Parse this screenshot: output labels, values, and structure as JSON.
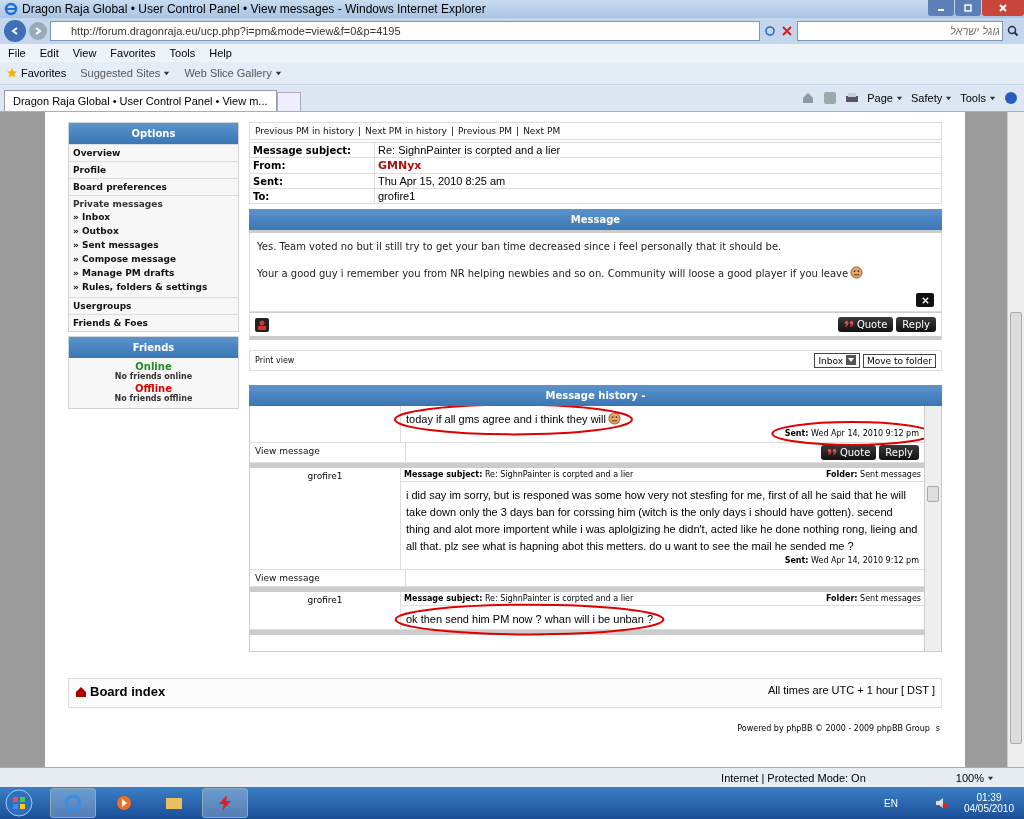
{
  "browser": {
    "title": "Dragon Raja Global • User Control Panel • View messages - Windows Internet Explorer",
    "address": "http://forum.dragonraja.eu/ucp.php?i=pm&mode=view&f=0&p=4195",
    "search_placeholder": "גוגל ישראל",
    "menu": [
      "File",
      "Edit",
      "View",
      "Favorites",
      "Tools",
      "Help"
    ],
    "favorites": "Favorites",
    "fav_links": [
      "Suggested Sites",
      "Web Slice Gallery"
    ],
    "tab": "Dragon Raja Global • User Control Panel • View m...",
    "commands": [
      "Page",
      "Safety",
      "Tools"
    ]
  },
  "sidebar": {
    "title": "Options",
    "items": [
      {
        "label": "Overview"
      },
      {
        "label": "Profile"
      },
      {
        "label": "Board preferences"
      },
      {
        "label": "Private messages",
        "children": [
          {
            "label": "» Inbox"
          },
          {
            "label": "» Outbox"
          },
          {
            "label": "» Sent messages"
          },
          {
            "label": "» Compose message"
          },
          {
            "label": "» Manage PM drafts"
          },
          {
            "label": "» Rules, folders & settings"
          }
        ]
      },
      {
        "label": "Usergroups"
      },
      {
        "label": "Friends & Foes"
      }
    ]
  },
  "friends": {
    "title": "Friends",
    "groups": [
      {
        "label": "Online",
        "color": "#228b22",
        "text": "No friends online"
      },
      {
        "label": "Offline",
        "color": "#dd0000",
        "text": "No friends offline"
      }
    ]
  },
  "message": {
    "nav": [
      "Previous PM in history",
      "Next PM in history",
      "Previous PM",
      "Next PM"
    ],
    "separator": "|",
    "headers": [
      {
        "label": "Message subject:",
        "value": "Re: SighnPainter is corpted and a lier",
        "kind": "text"
      },
      {
        "label": "From:",
        "value": "GMNyx",
        "kind": "user"
      },
      {
        "label": "Sent:",
        "value": "Thu Apr 15, 2010 8:25 am",
        "kind": "text"
      },
      {
        "label": "To:",
        "value": "grofire1",
        "kind": "text"
      }
    ],
    "title": "Message",
    "paragraphs": [
      "Yes. Team voted no but il still try to get your ban time decreased since i feel personally that it should be.",
      "Your a good guy i remember you from NR helping newbies and so on. Community will loose a good player if you leave"
    ],
    "quote": "Quote",
    "reply": "Reply",
    "print_view": "Print view",
    "folder_select": "Inbox",
    "move_button": "Move to folder"
  },
  "history": {
    "title": "Message history -",
    "entries": [
      {
        "body": "today if all gms agree and i think they will",
        "smiley": true,
        "body_circled": true,
        "sent_label": "Sent:",
        "sent": "Wed Apr 14, 2010 9:12 pm",
        "sent_circled": true,
        "view": "View message",
        "actions": [
          "Quote",
          "Reply"
        ]
      },
      {
        "author": "grofire1",
        "subject_label": "Message subject:",
        "subject": "Re: SighnPainter is corpted and a lier",
        "folder_label": "Folder:",
        "folder": "Sent messages",
        "body": "i did say im sorry, but is responed was some how very not stesfing for me, first of all he said that he will take down only the 3 days ban for corssing him (witch is the only days i should have gotten). secend thing and alot more importent while i was aplolgizing he didn't, acted like he done nothing rong, lieing and all that. plz see what is hapning abot this metters. do u want to see the mail he sended me ?",
        "smiley": false,
        "body_circled": false,
        "sent_label": "Sent:",
        "sent": "Wed Apr 14, 2010 9:12 pm",
        "sent_circled": false,
        "view": "View message"
      },
      {
        "author": "grofire1",
        "subject_label": "Message subject:",
        "subject": "Re: SighnPainter is corpted and a lier",
        "folder_label": "Folder:",
        "folder": "Sent messages",
        "body": "ok then send him PM now ? whan will i be unban ?",
        "smiley": false,
        "body_circled": true
      }
    ]
  },
  "footer": {
    "board_index": "Board index",
    "timezone": "All times are UTC + 1 hour [ DST ]",
    "powered": "Powered by phpBB © 2000 - 2009 phpBB Group",
    "powered_extra": "s"
  },
  "status_bar": {
    "zone": "Internet | Protected Mode: On",
    "zoom": "100%"
  },
  "taskbar": {
    "language": "EN",
    "time": "01:39",
    "date": "04/05/2010"
  }
}
